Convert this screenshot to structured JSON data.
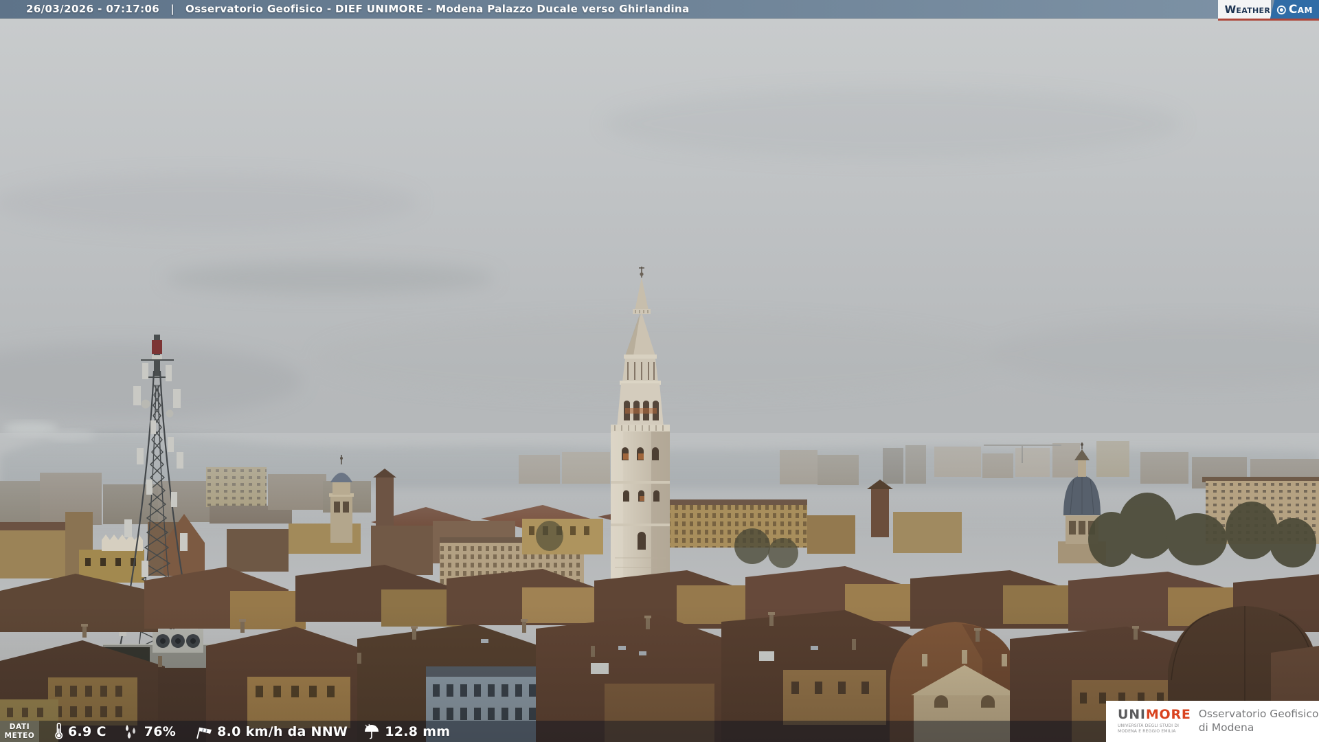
{
  "header": {
    "datetime": "26/03/2026 - 07:17:06",
    "separator": "|",
    "title": "Osservatorio Geofisico - DIEF UNIMORE - Modena Palazzo Ducale verso Ghirlandina"
  },
  "weathercam_logo": {
    "weather": "Weather",
    "cam": "Cam"
  },
  "meteo_bar": {
    "label_line1": "DATI",
    "label_line2": "METEO",
    "temperature": "6.9 C",
    "humidity": "76%",
    "wind": "8.0 km/h da NNW",
    "precipitation": "12.8 mm"
  },
  "unimore": {
    "uni": "UNI",
    "more": "MORE",
    "university_line1": "UNIVERSITÀ DEGLI STUDI DI",
    "university_line2": "MODENA E REGGIO EMILIA",
    "observatory_line1": "Osservatorio Geofisico",
    "observatory_line2": "di Modena"
  },
  "colors": {
    "top_bar": "#6b8095",
    "logo_red": "#ad4639",
    "cam_blue": "#2f6ca6",
    "unimore_red": "#d9431f"
  }
}
